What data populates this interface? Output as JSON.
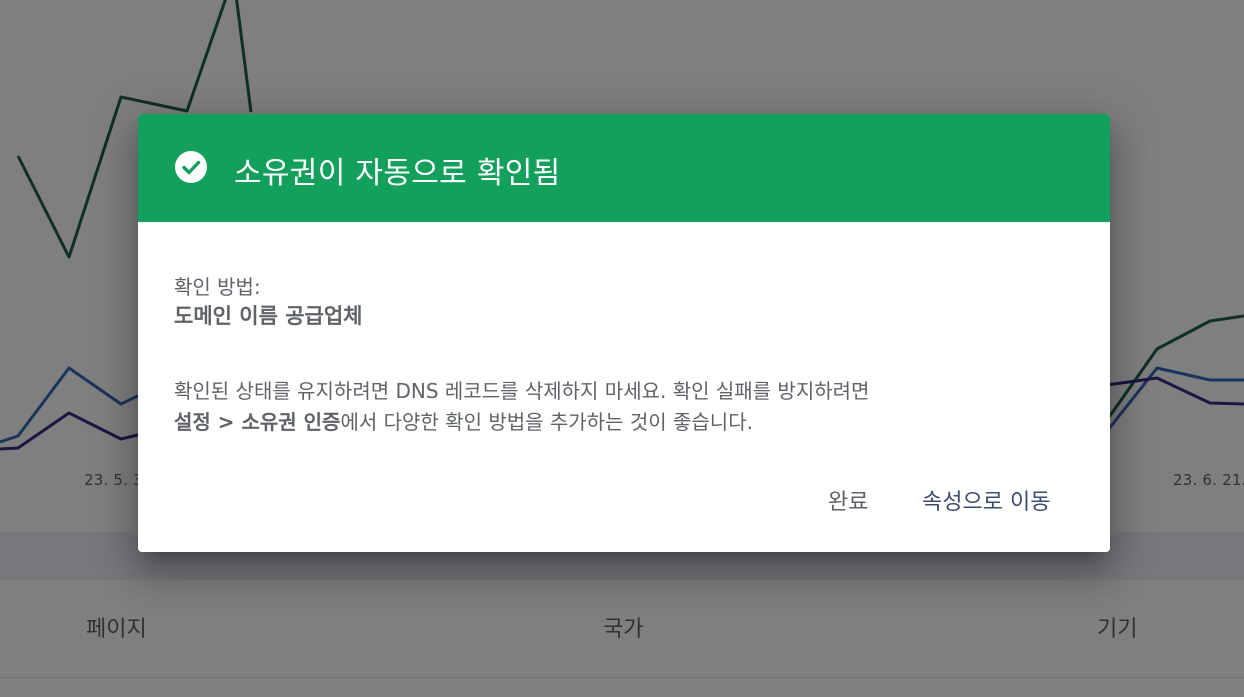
{
  "background": {
    "axis_dates": {
      "left_clip": ".",
      "left": "23. 5. 3",
      "right": "23. 6. 21."
    },
    "tabs": [
      "페이지",
      "국가",
      "기기"
    ],
    "series_colors": {
      "clicks": "#1f5e52",
      "impressions": "#3569b7",
      "ctr": "#3c2b86"
    }
  },
  "dialog": {
    "accent_color": "#12a05c",
    "icon": "check-circle-icon",
    "title": "소유권이 자동으로 확인됨",
    "method_label": "확인 방법:",
    "method_value": "도메인 이름 공급업체",
    "message_line1": "확인된 상태를 유지하려면 DNS 레코드를 삭제하지 마세요. 확인 실패를 방지하려면",
    "message_bold": "설정 > 소유권 인증",
    "message_line2_rest": "에서 다양한 확인 방법을 추가하는 것이 좋습니다.",
    "buttons": {
      "done": "완료",
      "go_to_property": "속성으로 이동"
    }
  }
}
